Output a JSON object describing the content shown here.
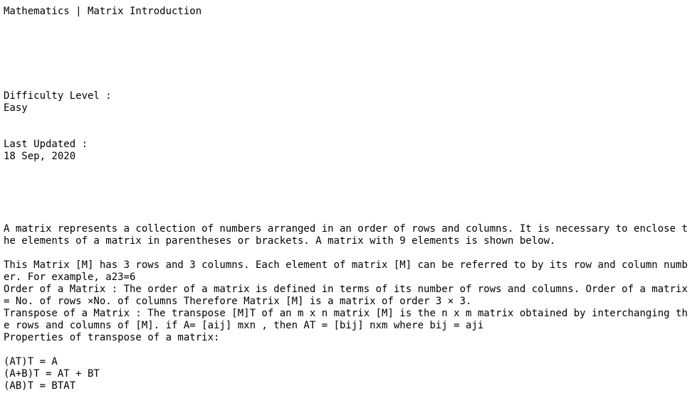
{
  "title": "Mathematics | Matrix Introduction",
  "difficulty": {
    "label": "Difficulty Level :",
    "value": "Easy"
  },
  "last_updated": {
    "label": "Last Updated :",
    "value": "18 Sep, 2020"
  },
  "intro": {
    "line1": "A matrix represents a collection of numbers arranged in an order of rows and columns. It is necessary to enclose t",
    "line2": "he elements of a matrix in parentheses or brackets. A matrix with 9 elements is shown below."
  },
  "body": {
    "line1": "This Matrix [M] has 3 rows and 3 columns. Each element of matrix [M] can be referred to by its row and column numb",
    "line2": "er. For example, a23=6",
    "line3": "Order of a Matrix : The order of a matrix is defined in terms of its number of rows and columns. Order of a matrix",
    "line4": "= No. of rows ×No. of columns Therefore Matrix [M] is a matrix of order 3 × 3.",
    "line5": "Transpose of a Matrix : The transpose [M]T of an m x n matrix [M] is the n x m matrix obtained by interchanging th",
    "line6": "e rows and columns of [M]. if A= [aij] mxn , then AT = [bij] nxm where bij = aji",
    "line7": "Properties of transpose of a matrix:"
  },
  "properties": [
    "(AT)T = A",
    "(A+B)T = AT + BT",
    "(AB)T = BTAT"
  ]
}
